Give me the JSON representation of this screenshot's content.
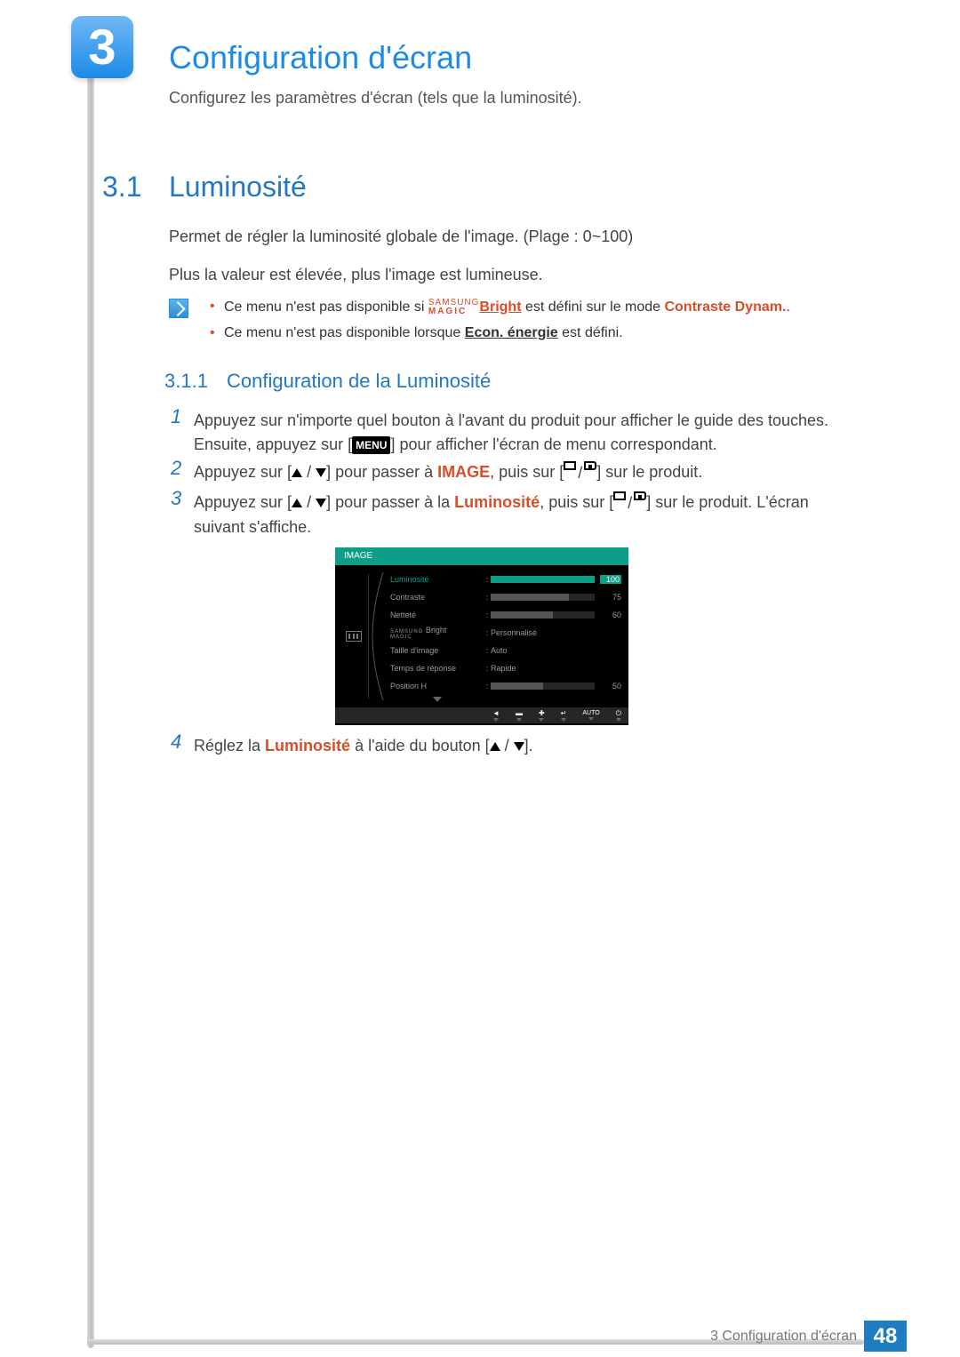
{
  "chapter": {
    "num": "3",
    "title": "Configuration d'écran",
    "subtitle": "Configurez les paramètres d'écran (tels que la luminosité)."
  },
  "h1": {
    "num": "3.1",
    "title": "Luminosité"
  },
  "para": {
    "p1": "Permet de régler la luminosité globale de l'image. (Plage : 0~100)",
    "p2": "Plus la valeur est élevée, plus l'image est lumineuse."
  },
  "magic": {
    "top": "SAMSUNG",
    "bottom": "MAGIC"
  },
  "notes": {
    "n1a": "Ce menu n'est pas disponible si ",
    "n1b": "Bright",
    "n1c": " est défini sur le mode ",
    "n1d": "Contraste Dynam.",
    "n1e": ".",
    "n2a": "Ce menu n'est pas disponible lorsque ",
    "n2b": "Econ. énergie",
    "n2c": " est défini."
  },
  "h2": {
    "num": "3.1.1",
    "title": "Configuration de la Luminosité"
  },
  "steps": {
    "s1n": "1",
    "s1a": "Appuyez sur n'importe quel bouton à l'avant du produit pour afficher le guide des touches. Ensuite, appuyez sur [",
    "s1b": "MENU",
    "s1c": "] pour afficher l'écran de menu correspondant.",
    "s2n": "2",
    "s2a": "Appuyez sur [",
    "s2b": "] pour passer à ",
    "s2c": "IMAGE",
    "s2d": ", puis sur [",
    "s2e": "] sur le produit.",
    "s3n": "3",
    "s3a": "Appuyez sur [",
    "s3b": "] pour passer à la ",
    "s3c": "Luminosité",
    "s3d": ", puis sur [",
    "s3e": "] sur le produit. L'écran suivant s'affiche.",
    "s4n": "4",
    "s4a": "Réglez la ",
    "s4b": "Luminosité",
    "s4c": " à l'aide du bouton [",
    "s4d": "]."
  },
  "osd": {
    "header": "IMAGE",
    "rows": {
      "r1": {
        "label": "Luminosité",
        "val": "100",
        "fill": 100
      },
      "r2": {
        "label": "Contraste",
        "val": "75",
        "fill": 75
      },
      "r3": {
        "label": "Netteté",
        "val": "60",
        "fill": 60
      },
      "r4": {
        "label": "Bright",
        "val": "Personnalisé"
      },
      "r5": {
        "label": "Taille d'image",
        "val": "Auto"
      },
      "r6": {
        "label": "Temps de réponse",
        "val": "Rapide"
      },
      "r7": {
        "label": "Position H",
        "val": "50",
        "fill": 50
      }
    },
    "footer": {
      "b1": "◄",
      "b2": "▬",
      "b3": "✚",
      "b4": "↵",
      "auto": "AUTO",
      "pwr": "⏻"
    }
  },
  "footer": {
    "label": "3 Configuration d'écran",
    "page": "48"
  }
}
